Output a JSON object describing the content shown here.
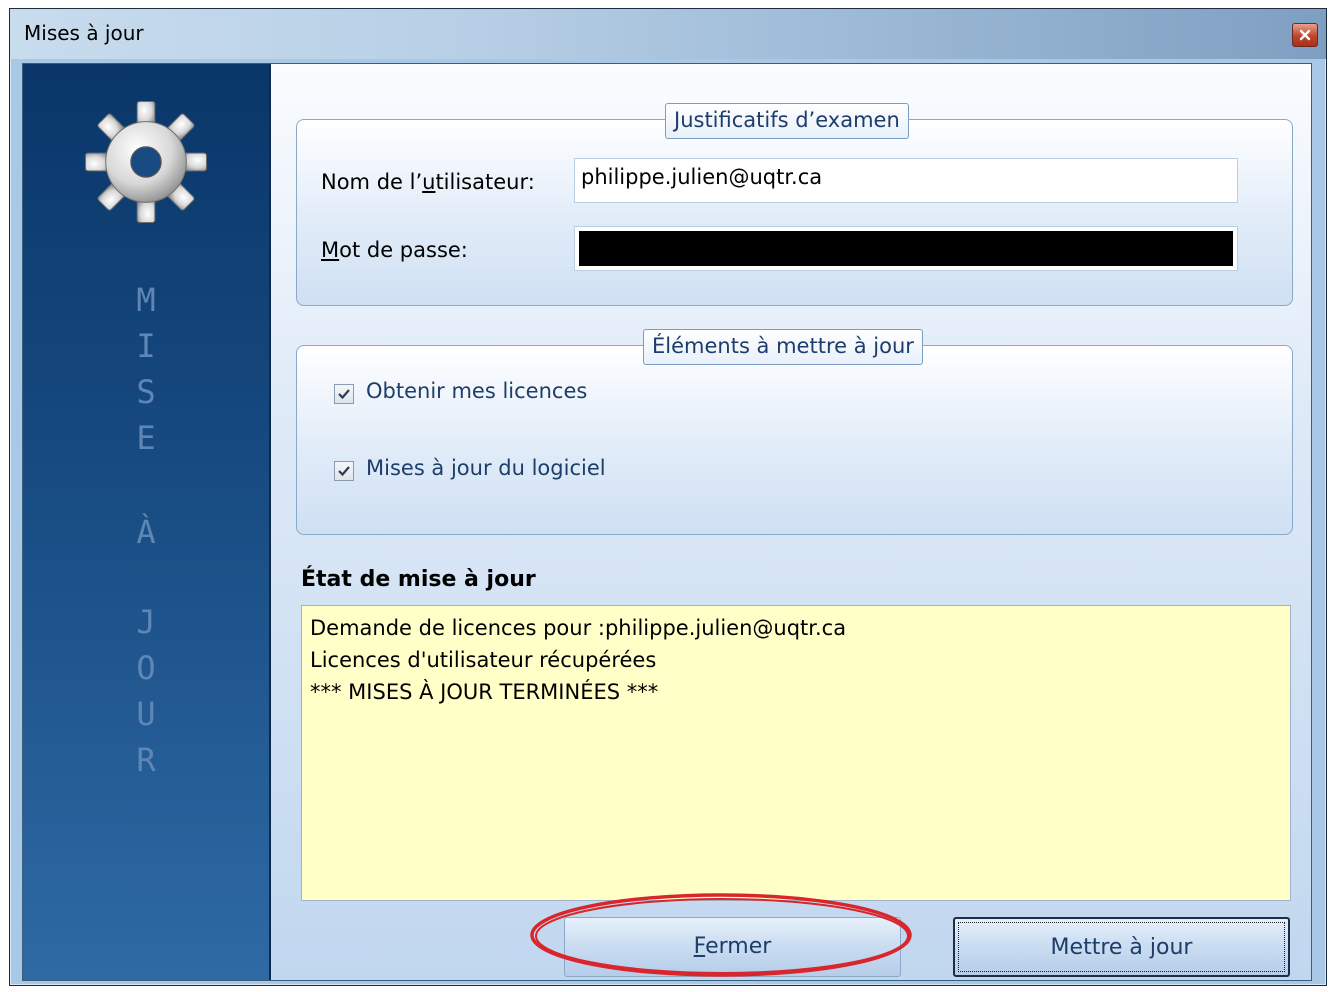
{
  "window": {
    "title": "Mises à jour"
  },
  "sidebar": {
    "letters_top": [
      "M",
      "I",
      "S",
      "E"
    ],
    "letters_mid": [
      "À"
    ],
    "letters_bottom": [
      "J",
      "O",
      "U",
      "R"
    ]
  },
  "credentials": {
    "legend": "Justificatifs d’examen",
    "username_label_pre": "Nom de l’",
    "username_label_u": "u",
    "username_label_post": "tilisateur:",
    "username_value": "philippe.julien@uqtr.ca",
    "password_label_u": "M",
    "password_label_post": "ot de passe:"
  },
  "items": {
    "legend": "Éléments à mettre à jour",
    "options": [
      {
        "label": "Obtenir mes licences",
        "checked": true
      },
      {
        "label": "Mises à jour du logiciel",
        "checked": true
      }
    ]
  },
  "status": {
    "title": "État de mise à jour",
    "lines": [
      "Demande de licences pour :philippe.julien@uqtr.ca",
      "Licences d'utilisateur récupérées",
      "*** MISES À JOUR TERMINÉES ***"
    ]
  },
  "buttons": {
    "close_u": "F",
    "close_rest": "ermer",
    "update": "Mettre à jour"
  },
  "icons": {
    "settings": "gear-icon",
    "window_close": "close-icon",
    "check": "checkmark-icon"
  },
  "colors": {
    "sidebar": "#0a3669",
    "log_background": "#ffffc7",
    "annotation": "#d8262c"
  }
}
